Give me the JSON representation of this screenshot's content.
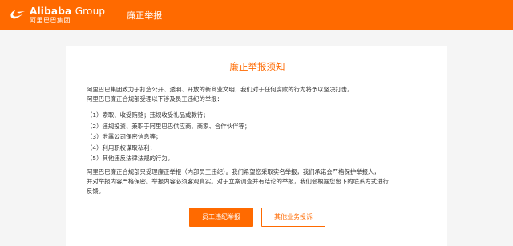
{
  "header": {
    "logo_en": "Alibaba",
    "logo_group": "Group",
    "logo_cn": "阿里巴巴集团",
    "page_name": "廉正举报",
    "accent_color": "#ff6a00"
  },
  "notice": {
    "title": "廉正举报须知",
    "intro_1": "阿里巴巴集团致力于打造公开、透明、开放的新商业文明，我们对于任何腐败的行为将予以坚决打击。",
    "intro_2": "阿里巴巴廉正合规部受理以下涉及员工违纪的举报：",
    "items": [
      "（1）索取、收受贿赂；违规收受礼品或款待；",
      "（2）违规投资、兼职于阿里巴巴供应商、商家、合作伙伴等；",
      "（3）泄露公司保密信息等；",
      "（4）利用职权谋取私利；",
      "（5）其他违反法律法规的行为。"
    ],
    "closing_1": "阿里巴巴廉正合规部只受理廉正举报（内部员工违纪）。我们希望您采取实名举报，我们承诺会严格保护举报人，",
    "closing_2": "并对举报内容严格保密。举报内容必须客观真实。对于立案调查并有结论的举报，我们会根据您留下的联系方式进行",
    "closing_3": "反馈。"
  },
  "buttons": {
    "employee_report": "员工违纪举报",
    "other_complaint": "其他业务投诉"
  }
}
